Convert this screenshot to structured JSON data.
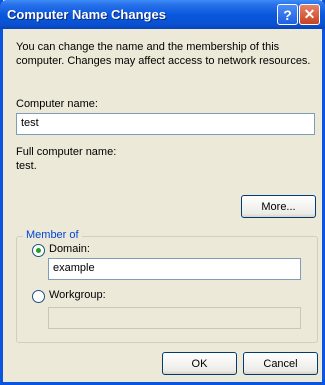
{
  "window": {
    "title": "Computer Name Changes",
    "help_label": "?",
    "close_label": "✕"
  },
  "description": "You can change the name and the membership of this computer. Changes may affect access to network resources.",
  "computer_name": {
    "label": "Computer name:",
    "value": "test"
  },
  "full_name": {
    "label": "Full computer name:",
    "value": "test."
  },
  "more_button": "More...",
  "member_of": {
    "label": "Member of",
    "domain": {
      "label": "Domain:",
      "selected": true,
      "value": "example"
    },
    "workgroup": {
      "label": "Workgroup:",
      "selected": false,
      "value": ""
    }
  },
  "buttons": {
    "ok": "OK",
    "cancel": "Cancel"
  }
}
